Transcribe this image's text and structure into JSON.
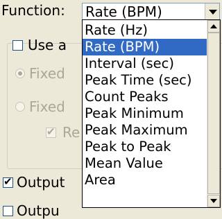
{
  "function_label": "Function:",
  "function_value": "Rate (BPM)",
  "group": {
    "use_label": "Use a",
    "fixed_1": "Fixed",
    "fixed_2": "Fixed",
    "re_label": "Re"
  },
  "output_label": "Output",
  "bottom_label": "Outpu",
  "dropdown": {
    "items": [
      "Rate (Hz)",
      "Rate (BPM)",
      "Interval (sec)",
      "Peak Time (sec)",
      "Count Peaks",
      "Peak Minimum",
      "Peak Maximum",
      "Peak to Peak",
      "Mean Value",
      "Area"
    ],
    "selected": "Rate (BPM)"
  },
  "colors": {
    "selection": "#316ac5",
    "disabled_text": "#aca899",
    "background": "#ece9d8"
  },
  "icons": {
    "checkmark": "check-icon",
    "combo_arrow": "chevron-down-icon"
  }
}
